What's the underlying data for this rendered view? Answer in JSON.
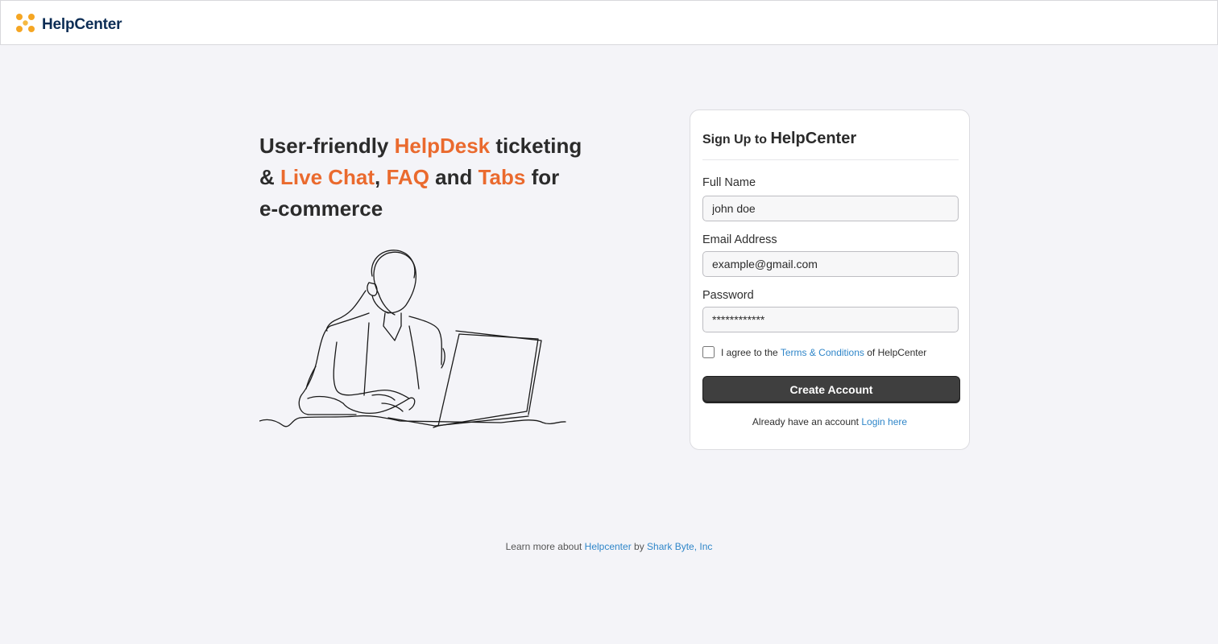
{
  "app": {
    "brand_name": "HelpCenter",
    "logo_colors": [
      "#f5a623",
      "#f5b942"
    ]
  },
  "hero": {
    "line1_plain_a": "User-friendly ",
    "line1_accent": "HelpDesk",
    "line1_plain_b": " ticketing",
    "line2_amp": "& ",
    "line2_accent_a": "Live Chat",
    "line2_comma": ", ",
    "line2_accent_b": "FAQ",
    "line2_and": " and ",
    "line2_accent_c": "Tabs",
    "line2_for": " for",
    "line3": "e-commerce",
    "accent_color": "#ea6a2e"
  },
  "signup": {
    "title_prefix": "Sign Up to ",
    "title_brand": "HelpCenter",
    "full_name_label": "Full Name",
    "full_name_value": "john doe",
    "email_label": "Email Address",
    "email_value": "example@gmail.com",
    "password_label": "Password",
    "password_value": "************",
    "agree_prefix": "I agree to the ",
    "agree_link": "Terms & Conditions",
    "agree_suffix": " of HelpCenter",
    "agree_checked": false,
    "submit_label": "Create Account",
    "login_prompt": "Already have an account ",
    "login_link": "Login here"
  },
  "footer": {
    "prefix": "Learn more about ",
    "link1": "Helpcenter",
    "middle": " by ",
    "link2": "Shark Byte, Inc"
  },
  "icons": {
    "logo": "helpcenter-logo-icon",
    "illustration": "support-agent-laptop-illustration"
  }
}
